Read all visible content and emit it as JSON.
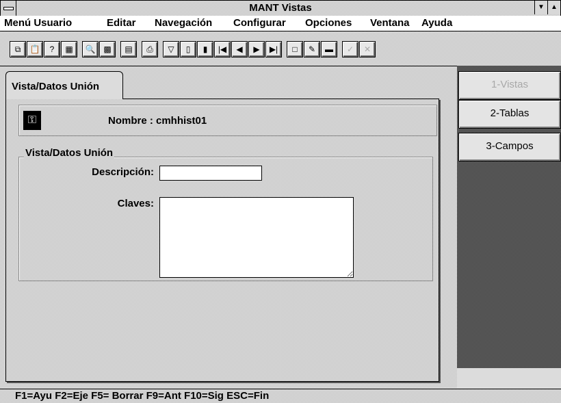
{
  "window": {
    "title": "MANT Vistas",
    "min_icon": "down-arrow-icon",
    "max_icon": "up-arrow-icon"
  },
  "menu": [
    {
      "label": "Menú Usuario"
    },
    {
      "label": "Editar"
    },
    {
      "label": "Navegación"
    },
    {
      "label": "Configurar"
    },
    {
      "label": "Opciones"
    },
    {
      "label": "Ventana"
    },
    {
      "label": "Ayuda"
    }
  ],
  "toolbar": [
    {
      "icon": "copy-icon",
      "glyph": "⧉"
    },
    {
      "icon": "paste-icon",
      "glyph": "📋"
    },
    {
      "icon": "query-icon",
      "glyph": "?"
    },
    {
      "icon": "form-icon",
      "glyph": "▦"
    },
    {
      "icon": "search-icon",
      "glyph": "🔍"
    },
    {
      "icon": "grid-icon",
      "glyph": "▩"
    },
    {
      "icon": "table-icon",
      "glyph": "▤"
    },
    {
      "icon": "print-icon",
      "glyph": "⎙"
    },
    {
      "icon": "filter-icon",
      "glyph": "▽"
    },
    {
      "icon": "column-icon",
      "glyph": "▯"
    },
    {
      "icon": "bar-chart-icon",
      "glyph": "▮"
    },
    {
      "icon": "first-record-icon",
      "glyph": "|◀"
    },
    {
      "icon": "prev-record-icon",
      "glyph": "◀"
    },
    {
      "icon": "next-record-icon",
      "glyph": "▶"
    },
    {
      "icon": "last-record-icon",
      "glyph": "▶|"
    },
    {
      "icon": "new-record-icon",
      "glyph": "□"
    },
    {
      "icon": "edit-icon",
      "glyph": "✎"
    },
    {
      "icon": "delete-icon",
      "glyph": "▬"
    },
    {
      "icon": "confirm-icon",
      "glyph": "✓"
    },
    {
      "icon": "cancel-icon",
      "glyph": "✕"
    }
  ],
  "tab": {
    "label": "Vista/Datos Unión"
  },
  "header": {
    "nombre": "Nombre : cmhhist01",
    "icon": "key-record-icon"
  },
  "group": {
    "title": "Vista/Datos Unión",
    "descripcion_label": "Descripción:",
    "descripcion_value": "",
    "claves_label": "Claves:",
    "claves_value": ""
  },
  "side_buttons": [
    {
      "label": "1-Vistas",
      "enabled": false
    },
    {
      "label": "2-Tablas",
      "enabled": true
    },
    {
      "label": "3-Campos",
      "enabled": true
    }
  ],
  "status": {
    "text": "F1=Ayu  F2=Eje  F5= Borrar  F9=Ant  F10=Sig  ESC=Fin"
  }
}
